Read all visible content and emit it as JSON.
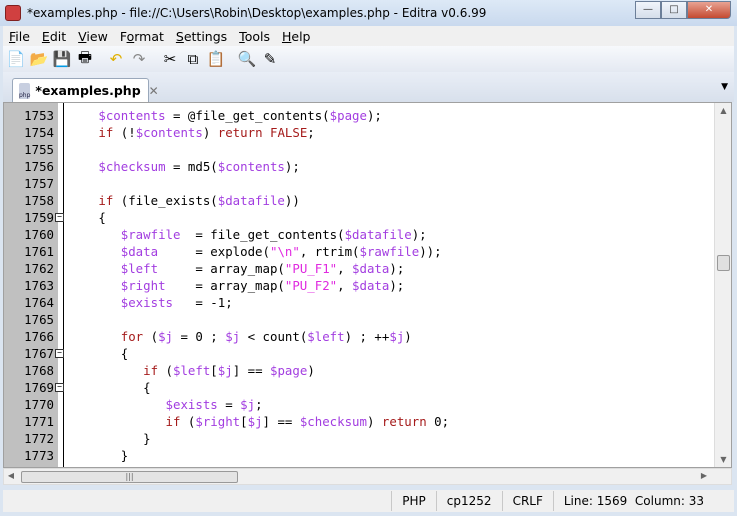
{
  "window": {
    "title": "*examples.php - file://C:\\Users\\Robin\\Desktop\\examples.php - Editra v0.6.99",
    "minimize": "—",
    "maximize": "□",
    "close": "✕"
  },
  "menu": [
    {
      "u": "F",
      "rest": "ile"
    },
    {
      "u": "E",
      "rest": "dit"
    },
    {
      "u": "V",
      "rest": "iew"
    },
    {
      "pre": "F",
      "u": "o",
      "rest": "rmat"
    },
    {
      "u": "S",
      "rest": "ettings"
    },
    {
      "u": "T",
      "rest": "ools"
    },
    {
      "u": "H",
      "rest": "elp"
    }
  ],
  "toolbar": [
    "new-file",
    "open",
    "save",
    "print",
    "undo",
    "redo",
    "cut",
    "copy",
    "paste",
    "find",
    "find-replace"
  ],
  "tab": {
    "label": "*examples.php",
    "close": "✕",
    "icon_text": "php",
    "menu": "▼"
  },
  "editor": {
    "lines": [
      {
        "n": "1753",
        "fold": false,
        "indent": 3,
        "t": [
          [
            "v",
            "$contents"
          ],
          [
            "p",
            " = @file_get_contents("
          ],
          [
            "v",
            "$page"
          ],
          [
            "p",
            ");"
          ]
        ]
      },
      {
        "n": "1754",
        "fold": false,
        "indent": 3,
        "t": [
          [
            "k",
            "if"
          ],
          [
            "p",
            " (!"
          ],
          [
            "v",
            "$contents"
          ],
          [
            "p",
            ") "
          ],
          [
            "k",
            "return FALSE"
          ],
          [
            "p",
            ";"
          ]
        ]
      },
      {
        "n": "1755",
        "fold": false,
        "indent": 0,
        "t": []
      },
      {
        "n": "1756",
        "fold": false,
        "indent": 3,
        "t": [
          [
            "v",
            "$checksum"
          ],
          [
            "p",
            " = md5("
          ],
          [
            "v",
            "$contents"
          ],
          [
            "p",
            ");"
          ]
        ]
      },
      {
        "n": "1757",
        "fold": false,
        "indent": 0,
        "t": []
      },
      {
        "n": "1758",
        "fold": false,
        "indent": 3,
        "t": [
          [
            "k",
            "if"
          ],
          [
            "p",
            " (file_exists("
          ],
          [
            "v",
            "$datafile"
          ],
          [
            "p",
            "))"
          ]
        ]
      },
      {
        "n": "1759",
        "fold": true,
        "indent": 3,
        "t": [
          [
            "p",
            "{"
          ]
        ]
      },
      {
        "n": "1760",
        "fold": false,
        "indent": 6,
        "t": [
          [
            "v",
            "$rawfile"
          ],
          [
            "p",
            "  = file_get_contents("
          ],
          [
            "v",
            "$datafile"
          ],
          [
            "p",
            ");"
          ]
        ]
      },
      {
        "n": "1761",
        "fold": false,
        "indent": 6,
        "t": [
          [
            "v",
            "$data"
          ],
          [
            "p",
            "     = explode("
          ],
          [
            "s",
            "\"\\n\""
          ],
          [
            "p",
            ", rtrim("
          ],
          [
            "v",
            "$rawfile"
          ],
          [
            "p",
            "));"
          ]
        ]
      },
      {
        "n": "1762",
        "fold": false,
        "indent": 6,
        "t": [
          [
            "v",
            "$left"
          ],
          [
            "p",
            "     = array_map("
          ],
          [
            "s",
            "\"PU_F1\""
          ],
          [
            "p",
            ", "
          ],
          [
            "v",
            "$data"
          ],
          [
            "p",
            ");"
          ]
        ]
      },
      {
        "n": "1763",
        "fold": false,
        "indent": 6,
        "t": [
          [
            "v",
            "$right"
          ],
          [
            "p",
            "    = array_map("
          ],
          [
            "s",
            "\"PU_F2\""
          ],
          [
            "p",
            ", "
          ],
          [
            "v",
            "$data"
          ],
          [
            "p",
            ");"
          ]
        ]
      },
      {
        "n": "1764",
        "fold": false,
        "indent": 6,
        "t": [
          [
            "v",
            "$exists"
          ],
          [
            "p",
            "   = -1;"
          ]
        ]
      },
      {
        "n": "1765",
        "fold": false,
        "indent": 0,
        "t": []
      },
      {
        "n": "1766",
        "fold": false,
        "indent": 6,
        "t": [
          [
            "k",
            "for"
          ],
          [
            "p",
            " ("
          ],
          [
            "v",
            "$j"
          ],
          [
            "p",
            " = 0 ; "
          ],
          [
            "v",
            "$j"
          ],
          [
            "p",
            " < count("
          ],
          [
            "v",
            "$left"
          ],
          [
            "p",
            ") ; ++"
          ],
          [
            "v",
            "$j"
          ],
          [
            "p",
            ")"
          ]
        ]
      },
      {
        "n": "1767",
        "fold": true,
        "indent": 6,
        "t": [
          [
            "p",
            "{"
          ]
        ]
      },
      {
        "n": "1768",
        "fold": false,
        "indent": 9,
        "t": [
          [
            "k",
            "if"
          ],
          [
            "p",
            " ("
          ],
          [
            "v",
            "$left"
          ],
          [
            "p",
            "["
          ],
          [
            "v",
            "$j"
          ],
          [
            "p",
            "] == "
          ],
          [
            "v",
            "$page"
          ],
          [
            "p",
            ")"
          ]
        ]
      },
      {
        "n": "1769",
        "fold": true,
        "indent": 9,
        "t": [
          [
            "p",
            "{"
          ]
        ]
      },
      {
        "n": "1770",
        "fold": false,
        "indent": 12,
        "t": [
          [
            "v",
            "$exists"
          ],
          [
            "p",
            " = "
          ],
          [
            "v",
            "$j"
          ],
          [
            "p",
            ";"
          ]
        ]
      },
      {
        "n": "1771",
        "fold": false,
        "indent": 12,
        "t": [
          [
            "k",
            "if"
          ],
          [
            "p",
            " ("
          ],
          [
            "v",
            "$right"
          ],
          [
            "p",
            "["
          ],
          [
            "v",
            "$j"
          ],
          [
            "p",
            "] == "
          ],
          [
            "v",
            "$checksum"
          ],
          [
            "p",
            ") "
          ],
          [
            "k",
            "return"
          ],
          [
            "p",
            " 0;"
          ]
        ]
      },
      {
        "n": "1772",
        "fold": false,
        "indent": 9,
        "t": [
          [
            "p",
            "}"
          ]
        ]
      },
      {
        "n": "1773",
        "fold": false,
        "indent": 6,
        "t": [
          [
            "p",
            "}"
          ]
        ]
      }
    ]
  },
  "status": {
    "lang": "PHP",
    "encoding": "cp1252",
    "eol": "CRLF",
    "position": "Line: 1569  Column: 33"
  },
  "colors": {
    "variable": "#a23de0",
    "keyword": "#a51b1b",
    "string": "#e02ae0"
  }
}
